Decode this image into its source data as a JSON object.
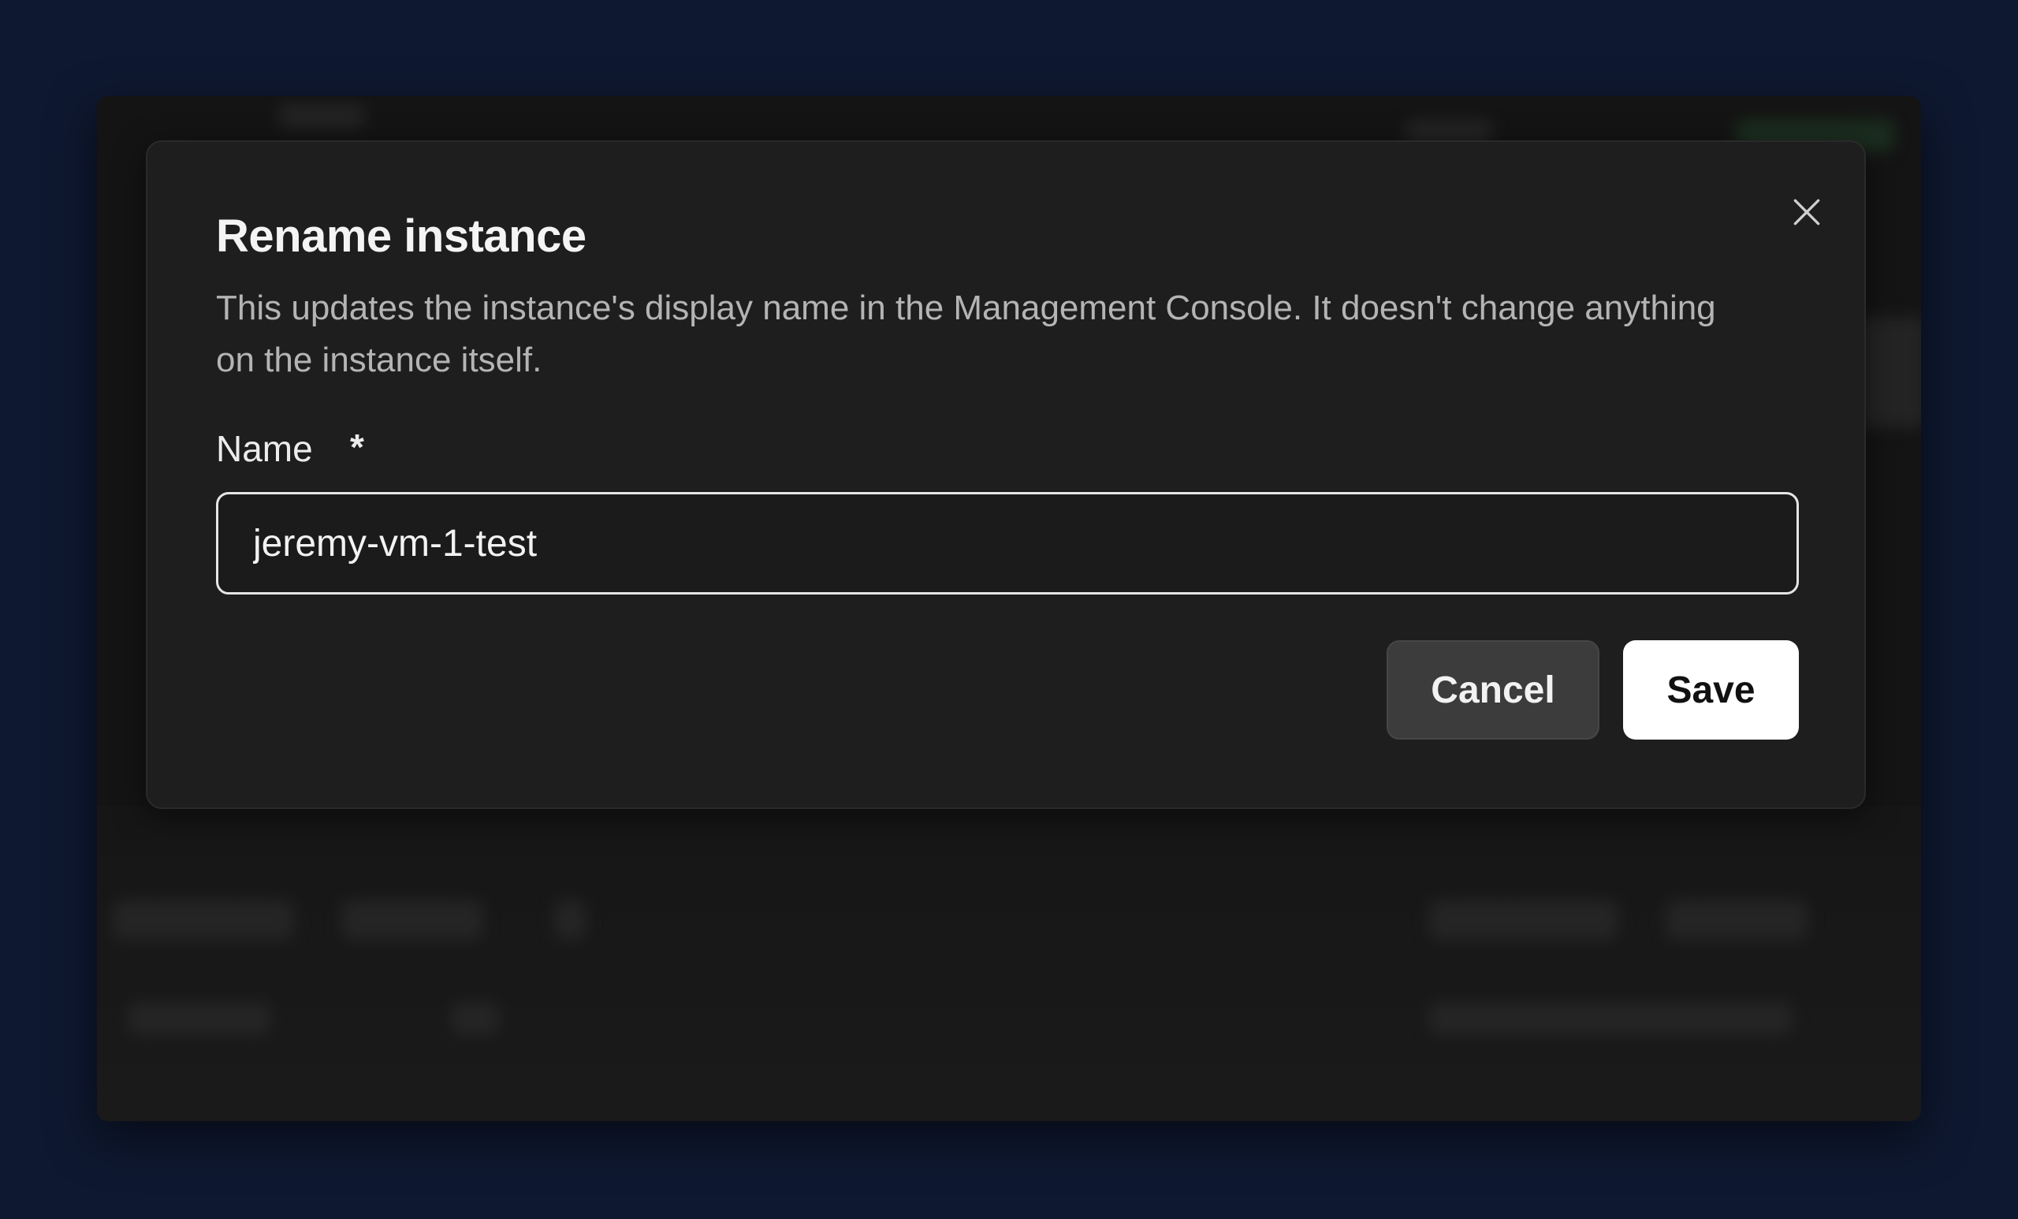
{
  "dialog": {
    "title": "Rename instance",
    "description": "This updates the instance's display name in the Management Console. It doesn't change anything on the instance itself.",
    "close_icon": "close-icon"
  },
  "form": {
    "name_label": "Name",
    "required_marker": "*",
    "name_value": "jeremy-vm-1-test"
  },
  "actions": {
    "cancel_label": "Cancel",
    "save_label": "Save"
  },
  "colors": {
    "page_background": "#0e1830",
    "dialog_background": "#1e1e1e",
    "save_button": "#ffffff",
    "cancel_button": "#3c3c3c"
  }
}
